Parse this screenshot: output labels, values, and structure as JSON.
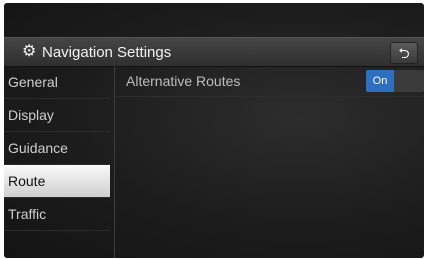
{
  "header": {
    "title": "Navigation Settings",
    "settings_icon": "gear-icon",
    "back_icon": "back-arrow-icon",
    "back_glyph": "⮌"
  },
  "sidebar": {
    "items": [
      {
        "label": "General",
        "active": false
      },
      {
        "label": "Display",
        "active": false
      },
      {
        "label": "Guidance",
        "active": false
      },
      {
        "label": "Route",
        "active": true
      },
      {
        "label": "Traffic",
        "active": false
      }
    ]
  },
  "content": {
    "options": [
      {
        "label": "Alternative Routes",
        "state": "On"
      }
    ]
  },
  "colors": {
    "accent": "#2e6fbf",
    "active_tab_bg": "#f2f2f2"
  }
}
